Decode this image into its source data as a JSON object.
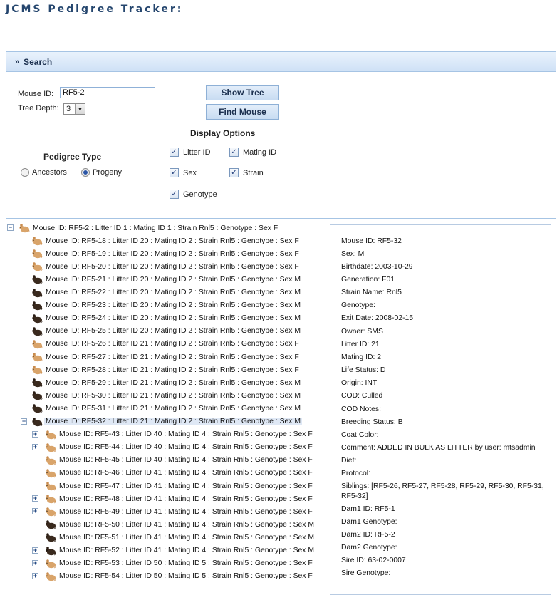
{
  "app": {
    "title": "JCMS Pedigree Tracker:"
  },
  "search": {
    "header": "Search",
    "mouse_id_label": "Mouse ID:",
    "mouse_id_value": "RF5-2",
    "tree_depth_label": "Tree Depth:",
    "tree_depth_value": "3",
    "show_tree_button": "Show Tree",
    "find_mouse_button": "Find Mouse",
    "display_options_title": "Display Options",
    "pedigree_type_title": "Pedigree Type",
    "pedigree_type_options": [
      {
        "label": "Ancestors",
        "selected": false
      },
      {
        "label": "Progeny",
        "selected": true
      }
    ],
    "display_options": [
      {
        "label": "Litter ID",
        "checked": true
      },
      {
        "label": "Mating ID",
        "checked": true
      },
      {
        "label": "Sex",
        "checked": true
      },
      {
        "label": "Strain",
        "checked": true
      },
      {
        "label": "Genotype",
        "checked": true
      }
    ]
  },
  "tree": {
    "nodes": [
      {
        "text": "Mouse ID: RF5-2 : Litter ID 1 : Mating ID 1 : Strain Rnl5 : Genotype : Sex F",
        "level": 0,
        "expander": "minus",
        "icon": "mouse-light-icon"
      },
      {
        "text": "Mouse ID: RF5-18 : Litter ID 20 : Mating ID 2 : Strain Rnl5 : Genotype : Sex F",
        "level": 1,
        "expander": "",
        "icon": "mouse-light-icon"
      },
      {
        "text": "Mouse ID: RF5-19 : Litter ID 20 : Mating ID 2 : Strain Rnl5 : Genotype : Sex F",
        "level": 1,
        "expander": "",
        "icon": "mouse-light-icon"
      },
      {
        "text": "Mouse ID: RF5-20 : Litter ID 20 : Mating ID 2 : Strain Rnl5 : Genotype : Sex F",
        "level": 1,
        "expander": "",
        "icon": "mouse-light-icon"
      },
      {
        "text": "Mouse ID: RF5-21 : Litter ID 20 : Mating ID 2 : Strain Rnl5 : Genotype : Sex M",
        "level": 1,
        "expander": "",
        "icon": "mouse-dark-icon"
      },
      {
        "text": "Mouse ID: RF5-22 : Litter ID 20 : Mating ID 2 : Strain Rnl5 : Genotype : Sex M",
        "level": 1,
        "expander": "",
        "icon": "mouse-dark-icon"
      },
      {
        "text": "Mouse ID: RF5-23 : Litter ID 20 : Mating ID 2 : Strain Rnl5 : Genotype : Sex M",
        "level": 1,
        "expander": "",
        "icon": "mouse-dark-icon"
      },
      {
        "text": "Mouse ID: RF5-24 : Litter ID 20 : Mating ID 2 : Strain Rnl5 : Genotype : Sex M",
        "level": 1,
        "expander": "",
        "icon": "mouse-dark-icon"
      },
      {
        "text": "Mouse ID: RF5-25 : Litter ID 20 : Mating ID 2 : Strain Rnl5 : Genotype : Sex M",
        "level": 1,
        "expander": "",
        "icon": "mouse-dark-icon"
      },
      {
        "text": "Mouse ID: RF5-26 : Litter ID 21 : Mating ID 2 : Strain Rnl5 : Genotype : Sex F",
        "level": 1,
        "expander": "",
        "icon": "mouse-light-icon"
      },
      {
        "text": "Mouse ID: RF5-27 : Litter ID 21 : Mating ID 2 : Strain Rnl5 : Genotype : Sex F",
        "level": 1,
        "expander": "",
        "icon": "mouse-light-icon"
      },
      {
        "text": "Mouse ID: RF5-28 : Litter ID 21 : Mating ID 2 : Strain Rnl5 : Genotype : Sex F",
        "level": 1,
        "expander": "",
        "icon": "mouse-light-icon"
      },
      {
        "text": "Mouse ID: RF5-29 : Litter ID 21 : Mating ID 2 : Strain Rnl5 : Genotype : Sex M",
        "level": 1,
        "expander": "",
        "icon": "mouse-dark-icon"
      },
      {
        "text": "Mouse ID: RF5-30 : Litter ID 21 : Mating ID 2 : Strain Rnl5 : Genotype : Sex M",
        "level": 1,
        "expander": "",
        "icon": "mouse-dark-icon"
      },
      {
        "text": "Mouse ID: RF5-31 : Litter ID 21 : Mating ID 2 : Strain Rnl5 : Genotype : Sex M",
        "level": 1,
        "expander": "",
        "icon": "mouse-dark-icon"
      },
      {
        "text": "Mouse ID: RF5-32 : Litter ID 21 : Mating ID 2 : Strain Rnl5 : Genotype : Sex M",
        "level": 1,
        "expander": "minus",
        "icon": "mouse-dark-icon",
        "selected": true
      },
      {
        "text": "Mouse ID: RF5-43 : Litter ID 40 : Mating ID 4 : Strain Rnl5 : Genotype : Sex F",
        "level": 2,
        "expander": "plus",
        "icon": "mouse-light-icon"
      },
      {
        "text": "Mouse ID: RF5-44 : Litter ID 40 : Mating ID 4 : Strain Rnl5 : Genotype : Sex F",
        "level": 2,
        "expander": "plus",
        "icon": "mouse-light-icon"
      },
      {
        "text": "Mouse ID: RF5-45 : Litter ID 40 : Mating ID 4 : Strain Rnl5 : Genotype : Sex F",
        "level": 2,
        "expander": "",
        "icon": "mouse-light-icon"
      },
      {
        "text": "Mouse ID: RF5-46 : Litter ID 41 : Mating ID 4 : Strain Rnl5 : Genotype : Sex F",
        "level": 2,
        "expander": "",
        "icon": "mouse-light-icon"
      },
      {
        "text": "Mouse ID: RF5-47 : Litter ID 41 : Mating ID 4 : Strain Rnl5 : Genotype : Sex F",
        "level": 2,
        "expander": "",
        "icon": "mouse-light-icon"
      },
      {
        "text": "Mouse ID: RF5-48 : Litter ID 41 : Mating ID 4 : Strain Rnl5 : Genotype : Sex F",
        "level": 2,
        "expander": "plus",
        "icon": "mouse-light-icon"
      },
      {
        "text": "Mouse ID: RF5-49 : Litter ID 41 : Mating ID 4 : Strain Rnl5 : Genotype : Sex F",
        "level": 2,
        "expander": "plus",
        "icon": "mouse-light-icon"
      },
      {
        "text": "Mouse ID: RF5-50 : Litter ID 41 : Mating ID 4 : Strain Rnl5 : Genotype : Sex M",
        "level": 2,
        "expander": "",
        "icon": "mouse-dark-icon"
      },
      {
        "text": "Mouse ID: RF5-51 : Litter ID 41 : Mating ID 4 : Strain Rnl5 : Genotype : Sex M",
        "level": 2,
        "expander": "",
        "icon": "mouse-dark-icon"
      },
      {
        "text": "Mouse ID: RF5-52 : Litter ID 41 : Mating ID 4 : Strain Rnl5 : Genotype : Sex M",
        "level": 2,
        "expander": "plus",
        "icon": "mouse-dark-icon"
      },
      {
        "text": "Mouse ID: RF5-53 : Litter ID 50 : Mating ID 5 : Strain Rnl5 : Genotype : Sex F",
        "level": 2,
        "expander": "plus",
        "icon": "mouse-light-icon"
      },
      {
        "text": "Mouse ID: RF5-54 : Litter ID 50 : Mating ID 5 : Strain Rnl5 : Genotype : Sex F",
        "level": 2,
        "expander": "plus",
        "icon": "mouse-light-icon"
      }
    ]
  },
  "details": {
    "lines": [
      "Mouse ID: RF5-32",
      "Sex: M",
      "Birthdate: 2003-10-29",
      "Generation: F01",
      "Strain Name: Rnl5",
      "Genotype:",
      "Exit Date: 2008-02-15",
      "Owner: SMS",
      "Litter ID: 21",
      "Mating ID: 2",
      "Life Status: D",
      "Origin: INT",
      "COD: Culled",
      "COD Notes:",
      "Breeding Status: B",
      "Coat Color:",
      "Comment: ADDED IN BULK AS LITTER by user: mtsadmin",
      "Diet:",
      "Protocol:",
      "Siblings: [RF5-26, RF5-27, RF5-28, RF5-29, RF5-30, RF5-31, RF5-32]",
      "Dam1 ID: RF5-1",
      "Dam1 Genotype:",
      "Dam2 ID: RF5-2",
      "Dam2 Genotype:",
      "Sire ID: 63-02-0007",
      "Sire Genotype:"
    ]
  }
}
